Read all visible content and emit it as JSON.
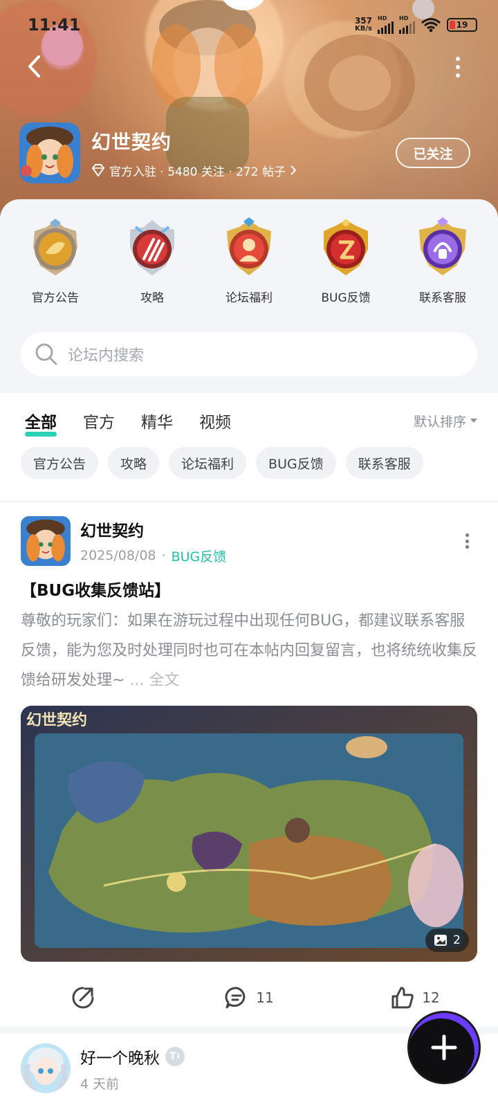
{
  "status_bar": {
    "time": "11:41",
    "net_speed": "357",
    "net_unit": "KB/s",
    "hd1": "HD",
    "hd2": "HD",
    "battery": "19"
  },
  "header": {
    "game_name": "幻世契约",
    "meta": "官方入驻 · 5480 关注 · 272 帖子",
    "follow_label": "已关注"
  },
  "categories": [
    {
      "label": "官方公告",
      "color": "#d9a02a"
    },
    {
      "label": "攻略",
      "color": "#d32f2f"
    },
    {
      "label": "论坛福利",
      "color": "#e53935"
    },
    {
      "label": "BUG反馈",
      "color": "#c62828"
    },
    {
      "label": "联系客服",
      "color": "#7b4bd8"
    }
  ],
  "search": {
    "placeholder": "论坛内搜索"
  },
  "tabs": [
    "全部",
    "官方",
    "精华",
    "视频"
  ],
  "sort_label": "默认排序",
  "chips": [
    "官方公告",
    "攻略",
    "论坛福利",
    "BUG反馈",
    "联系客服"
  ],
  "post": {
    "author": "幻世契约",
    "date": "2025/08/08",
    "tag": "BUG反馈",
    "title": "【BUG收集反馈站】",
    "body": "尊敬的玩家们：如果在游玩过程中出现任何BUG，都建议联系客服反馈，能为您及时处理同时也可在本帖内回复留言，也将统统收集反馈给研发处理~",
    "more_label": "... 全文",
    "image_watermark": "幻世契约",
    "image_count": "2",
    "comments": "11",
    "likes": "12"
  },
  "next_post": {
    "author": "好一个晚秋",
    "level": "1",
    "time": "4 天前"
  },
  "colors": {
    "accent": "#2ad1b5",
    "tag": "#20c0a4"
  }
}
